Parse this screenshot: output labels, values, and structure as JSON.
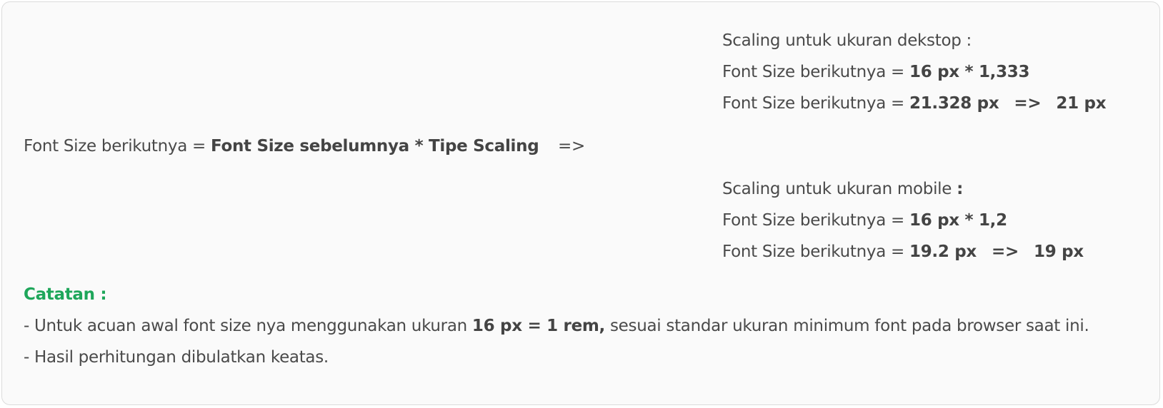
{
  "main": {
    "prefix": "Font Size berikutnya = ",
    "formula": "Font Size sebelumnya * Tipe Scaling",
    "arrow": "=>"
  },
  "desktop": {
    "title": "Scaling untuk ukuran dekstop :",
    "line1_prefix": "Font Size berikutnya = ",
    "line1_value": "16 px * 1,333",
    "line2_prefix": "Font Size berikutnya = ",
    "line2_value": "21.328 px",
    "line2_arrow": "=>",
    "line2_result": "21 px"
  },
  "mobile": {
    "title": "Scaling untuk ukuran mobile ",
    "title_colon": ":",
    "line1_prefix": "Font Size berikutnya = ",
    "line1_value": "16 px * 1,2",
    "line2_prefix": "Font Size berikutnya = ",
    "line2_value": "19.2 px",
    "line2_arrow": "=>",
    "line2_result": "19 px"
  },
  "notes": {
    "title": "Catatan :",
    "item1_prefix": "- Untuk acuan awal font size nya menggunakan ukuran ",
    "item1_bold": "16 px = 1 rem,",
    "item1_suffix": " sesuai standar ukuran minimum font pada browser saat ini.",
    "item2": "- Hasil perhitungan dibulatkan keatas."
  },
  "colors": {
    "text": "#4a4a4a",
    "accent_green": "#1ea65a",
    "card_bg": "#fafafa",
    "card_border": "#dcdcdc"
  }
}
